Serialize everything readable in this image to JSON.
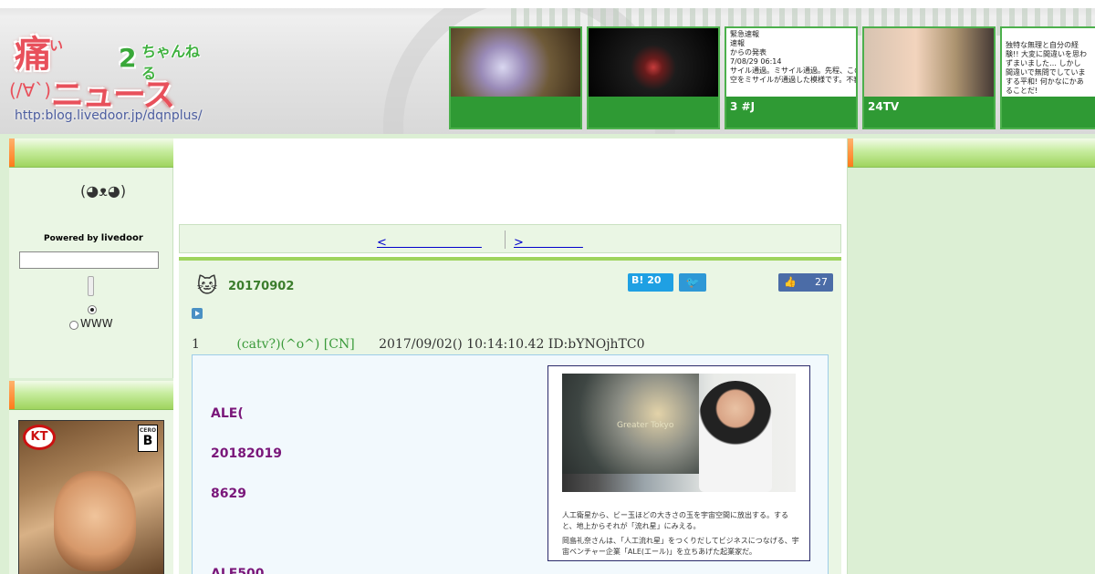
{
  "header": {
    "logo": {
      "kanji": "痛",
      "ita_small": "い",
      "two": "2",
      "channel": "ちゃんねる",
      "face": "(/∀`)",
      "news": "ニュース",
      "url": "http:blog.livedoor.jp/dqnplus/"
    },
    "thumbnails": [
      {
        "caption": ""
      },
      {
        "caption": ""
      },
      {
        "caption": "3 #J",
        "news_text": "緊急速報\n速報\nからの発表\n7/08/29 06:14\nサイル通過。ミサイル通過。先程、この\n空をミサイルが通過した模様です。不審"
      },
      {
        "caption": "24TV"
      },
      {
        "caption": "",
        "news_text": "独特な無理と自分の経験!! 大変に間違いを思わずまいました… しかし間違いで無問でしていまする平和! 何かなにかあることだ!"
      }
    ]
  },
  "left_sidebar": {
    "avatar": "(◕ᴥ◕)",
    "powered_by": "Powered by",
    "livedoor": "livedoor",
    "search_value": "",
    "radio_www": "WWW"
  },
  "ad": {
    "kt_logo": "KT",
    "cero_label": "CERO",
    "cero_rating": "B"
  },
  "nav": {
    "prev_label": "<　　　　　　　　",
    "next_label": ">　　　　　"
  },
  "article": {
    "cat_icon": "🐱",
    "date": "20170902",
    "hatena_label": "B!",
    "hatena_count": "20",
    "twitter_icon": "🐦",
    "fb_like_icon": "👍",
    "fb_count": "27",
    "res_number": "1",
    "res_name": "(catv?)(^o^) [CN]",
    "res_datetime": "2017/09/02() 10:14:10.42 ID:bYNOjhTC0",
    "lines": [
      "ALE(",
      "20182019",
      "8629",
      "ALE500"
    ]
  },
  "photo": {
    "overlay_text": "Greater Tokyo",
    "caption1": "人工衛星から、ビー玉ほどの大きさの玉を宇宙空間に放出する。すると、地上からそれが「流れ星」にみえる。",
    "caption2": "岡島礼奈さんは、「人工流れ星」をつくりだしてビジネスにつなげる、宇宙ベンチャー企業「ALE(エール)」を立ちあげた起業家だ。"
  }
}
